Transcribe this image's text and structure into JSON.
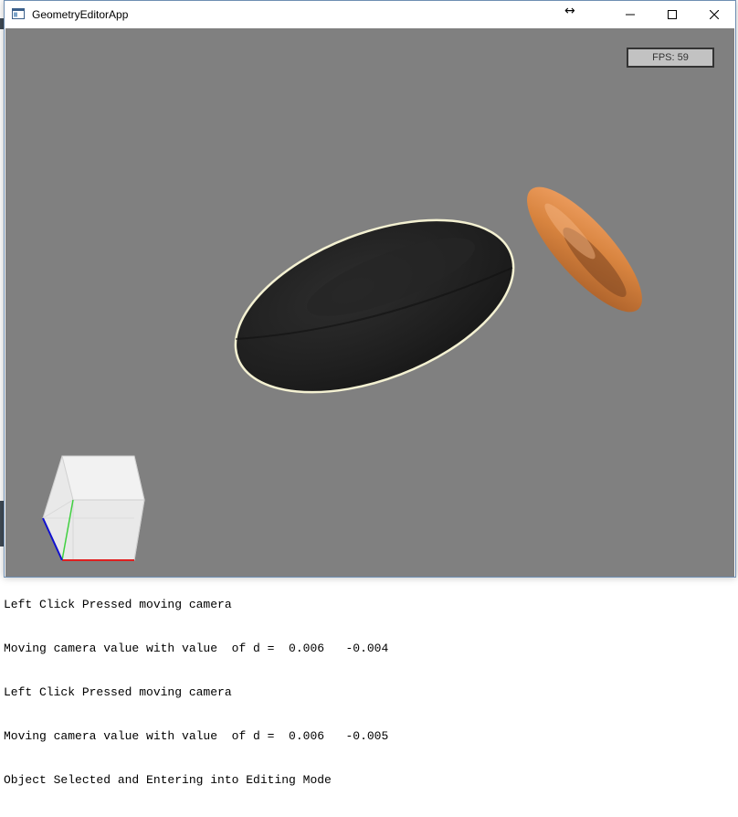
{
  "window": {
    "title": "GeometryEditorApp",
    "fps_label": "FPS: 59"
  },
  "viewport": {
    "background": "#808080",
    "objects": [
      {
        "name": "selected-torus",
        "color": "#1e1e1e",
        "outline": "#f4f1d2",
        "selected": true
      },
      {
        "name": "orange-torus",
        "color": "#d8843f",
        "selected": false
      }
    ],
    "orientation_gizmo": {
      "axes": {
        "x": "#e02020",
        "y": "#40d040",
        "z": "#1010d0"
      }
    }
  },
  "console": {
    "lines": [
      "Left Click Pressed moving camera",
      "Moving camera value with value  of d =  0.006   -0.004",
      "Left Click Pressed moving camera",
      "Moving camera value with value  of d =  0.006   -0.005",
      "Object Selected and Entering into Editing Mode"
    ]
  },
  "icons": {
    "app": "app-window-icon",
    "resize": "horizontal-resize-cursor-icon",
    "minimize": "minimize-icon",
    "maximize": "maximize-icon",
    "close": "close-icon"
  }
}
